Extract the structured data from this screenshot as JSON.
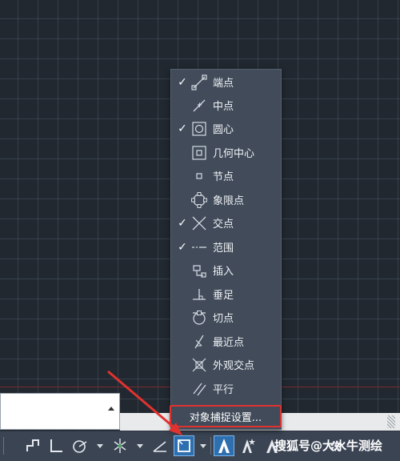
{
  "snap_menu": {
    "items": [
      {
        "label": "端点",
        "checked": true,
        "icon": "endpoint-icon"
      },
      {
        "label": "中点",
        "checked": false,
        "icon": "midpoint-icon"
      },
      {
        "label": "圆心",
        "checked": true,
        "icon": "center-icon"
      },
      {
        "label": "几何中心",
        "checked": false,
        "icon": "geometric-center-icon"
      },
      {
        "label": "节点",
        "checked": false,
        "icon": "node-icon"
      },
      {
        "label": "象限点",
        "checked": false,
        "icon": "quadrant-icon"
      },
      {
        "label": "交点",
        "checked": true,
        "icon": "intersection-icon"
      },
      {
        "label": "范围",
        "checked": true,
        "icon": "extension-icon"
      },
      {
        "label": "插入",
        "checked": false,
        "icon": "insertion-icon"
      },
      {
        "label": "垂足",
        "checked": false,
        "icon": "perpendicular-icon"
      },
      {
        "label": "切点",
        "checked": false,
        "icon": "tangent-icon"
      },
      {
        "label": "最近点",
        "checked": false,
        "icon": "nearest-icon"
      },
      {
        "label": "外观交点",
        "checked": false,
        "icon": "apparent-intersection-icon"
      },
      {
        "label": "平行",
        "checked": false,
        "icon": "parallel-icon"
      }
    ],
    "settings_label": "对象捕捉设置..."
  },
  "check_mark": "✓",
  "watermark": "搜狐号@大水牛测绘",
  "colors": {
    "canvas_bg": "#212830",
    "menu_bg": "#414b5a",
    "status_bar_bg": "#3b4453",
    "highlight_red": "#e0322f",
    "active_blue": "#2e6fb0"
  }
}
